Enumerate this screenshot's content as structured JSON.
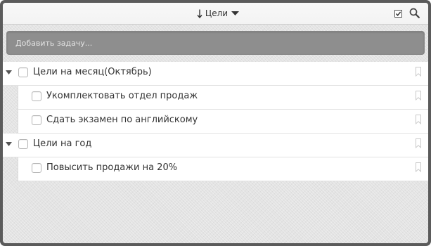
{
  "header": {
    "sort_icon": "sort-arrow-down-icon",
    "title": "Цели",
    "dropdown_icon": "caret-down-icon",
    "select_icon": "checkbox-icon",
    "search_icon": "search-icon"
  },
  "add_task": {
    "placeholder": "Добавить задачу..."
  },
  "icons": {
    "group_toggle": "triangle-down-icon",
    "row_action": "bookmark-icon"
  },
  "groups": [
    {
      "label": "Цели на месяц(Октябрь)",
      "expanded": true,
      "checked": false,
      "tasks": [
        {
          "label": "Укомплектовать отдел продаж",
          "checked": false
        },
        {
          "label": "Сдать экзамен по английскому",
          "checked": false
        }
      ]
    },
    {
      "label": "Цели на год",
      "expanded": true,
      "checked": false,
      "tasks": [
        {
          "label": "Повысить продажи на 20%",
          "checked": false
        }
      ]
    }
  ],
  "colors": {
    "frame": "#5b5b5b",
    "header_bg": "#f3f3f3",
    "input_bar": "#8e8e8e",
    "placeholder": "#e4e4e4",
    "text": "#333333"
  }
}
